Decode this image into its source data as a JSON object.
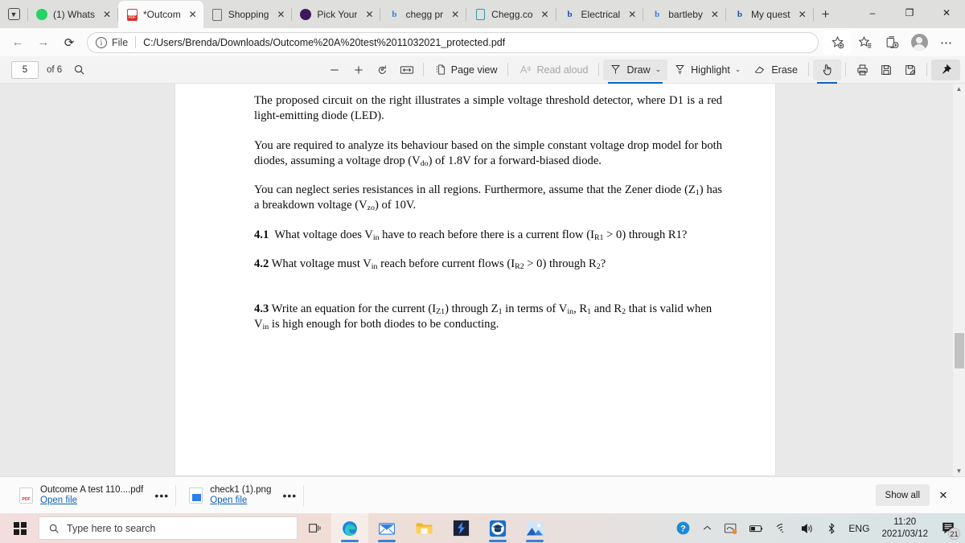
{
  "browser": {
    "tabs": [
      {
        "title": "(1) Whats",
        "icon": "whatsapp-icon",
        "active": false
      },
      {
        "title": "*Outcom",
        "icon": "pdf-icon",
        "active": true
      },
      {
        "title": "Shopping",
        "icon": "document-icon",
        "active": false
      },
      {
        "title": "Pick Your",
        "icon": "premier-league-icon",
        "active": false
      },
      {
        "title": "chegg pr",
        "icon": "bing-icon",
        "active": false
      },
      {
        "title": "Chegg.co",
        "icon": "chegg-icon",
        "active": false
      },
      {
        "title": "Electrical",
        "icon": "bartleby-icon",
        "active": false
      },
      {
        "title": "bartleby",
        "icon": "bing-icon",
        "active": false
      },
      {
        "title": "My quest",
        "icon": "bartleby-icon",
        "active": false
      }
    ],
    "new_tab_label": "+",
    "tab_list_icon": "tab-actions-icon",
    "window_controls": {
      "minimize": "–",
      "maximize": "❐",
      "close": "✕"
    },
    "nav": {
      "back": "←",
      "forward": "→",
      "refresh": "↻"
    },
    "omnibox": {
      "info_icon_label": "ⓘ",
      "file_label": "File",
      "url": "C:/Users/Brenda/Downloads/Outcome%20A%20test%2011032021_protected.pdf"
    },
    "toolbar_right": [
      {
        "name": "add-to-favorites-icon",
        "label": "☆"
      },
      {
        "name": "favorites-icon",
        "label": "☆"
      },
      {
        "name": "collections-icon",
        "label": "⧉"
      },
      {
        "name": "profile-avatar",
        "label": ""
      },
      {
        "name": "settings-and-more-icon",
        "label": "⋯"
      }
    ]
  },
  "pdf_toolbar": {
    "page_number": "5",
    "page_count_label": "of 6",
    "search_icon": "search-icon",
    "zoom_out_label": "−",
    "zoom_in_label": "+",
    "rotate_label": "rotate-icon",
    "fit_width_label": "fit-to-width-icon",
    "page_view_label": "Page view",
    "read_aloud_label": "Read aloud",
    "draw_label": "Draw",
    "highlight_label": "Highlight",
    "erase_label": "Erase",
    "chevron": "⌄",
    "touch_tool_name": "touch-draw-icon",
    "print_name": "print-icon",
    "save_name": "save-icon",
    "save_as_name": "save-as-icon",
    "pin_name": "pin-icon"
  },
  "document": {
    "paragraphs": [
      {
        "id": "p1",
        "html": "The proposed circuit on the right illustrates a simple voltage threshold detector, where D1 is a red light-emitting diode (LED)."
      },
      {
        "id": "p2",
        "html": "You are required to analyze its behaviour based on the simple constant voltage drop model for both diodes, assuming a voltage drop (V<sub>do</sub>) of 1.8V for a forward-biased diode."
      },
      {
        "id": "p3",
        "html": "You can neglect series resistances in all regions. Furthermore, assume that the Zener diode (Z<sub>1</sub>) has a breakdown voltage (V<sub>zo</sub>) of 10V."
      },
      {
        "id": "q41",
        "html": "<b>4.1</b>&nbsp; What voltage does V<sub>in</sub> have to reach before there is a current flow (I<sub>R1</sub> &gt; 0) through R1?"
      },
      {
        "id": "q42",
        "html": "<b>4.2</b> What voltage must V<sub>in</sub> reach before current flows (I<sub>R2</sub> &gt; 0) through R<sub>2</sub>?"
      },
      {
        "id": "q43",
        "html": "<b>4.3</b> Write an equation for the current (I<sub>Z1</sub>) through Z<sub>1</sub> in terms of V<sub>in</sub>, R<sub>1</sub> and R<sub>2</sub> that is valid when V<sub>in</sub> is high enough for both diodes to be conducting."
      }
    ]
  },
  "downloads": {
    "items": [
      {
        "name": "Outcome A test 110....pdf",
        "action": "Open file",
        "icon": "pdf-file-icon"
      },
      {
        "name": "check1 (1).png",
        "action": "Open file",
        "icon": "png-file-icon"
      }
    ],
    "more_label": "•••",
    "show_all_label": "Show all",
    "close_label": "✕"
  },
  "taskbar": {
    "start_icon": "windows-start-icon",
    "search_placeholder": "Type here to search",
    "task_view_icon": "task-view-icon",
    "apps": [
      {
        "name": "edge-icon",
        "running": true,
        "active": true
      },
      {
        "name": "mail-icon",
        "running": true,
        "active": false
      },
      {
        "name": "file-explorer-icon",
        "running": false,
        "active": false
      },
      {
        "name": "app-lightning-icon",
        "running": false,
        "active": false
      },
      {
        "name": "graduation-app-icon",
        "running": true,
        "active": false
      },
      {
        "name": "photos-icon",
        "running": true,
        "active": false
      }
    ],
    "tray": {
      "help_icon": "help-icon",
      "show_hidden_icon": "ⱏ",
      "onedrive_icon": "onedrive-sync-icon",
      "battery_icon": "battery-icon",
      "network_icon": "wifi-icon",
      "volume_icon": "volume-icon",
      "bluetooth_icon": "bluetooth-icon",
      "language": "ENG",
      "time": "11:20",
      "date": "2021/03/12",
      "notifications_count": "21"
    }
  },
  "colors": {
    "accent": "#0a64c2",
    "link": "#1062b4",
    "tabstrip": "#dfdfde",
    "toolbar": "#f3f3f3",
    "viewer_bg": "#e9e9e9"
  }
}
